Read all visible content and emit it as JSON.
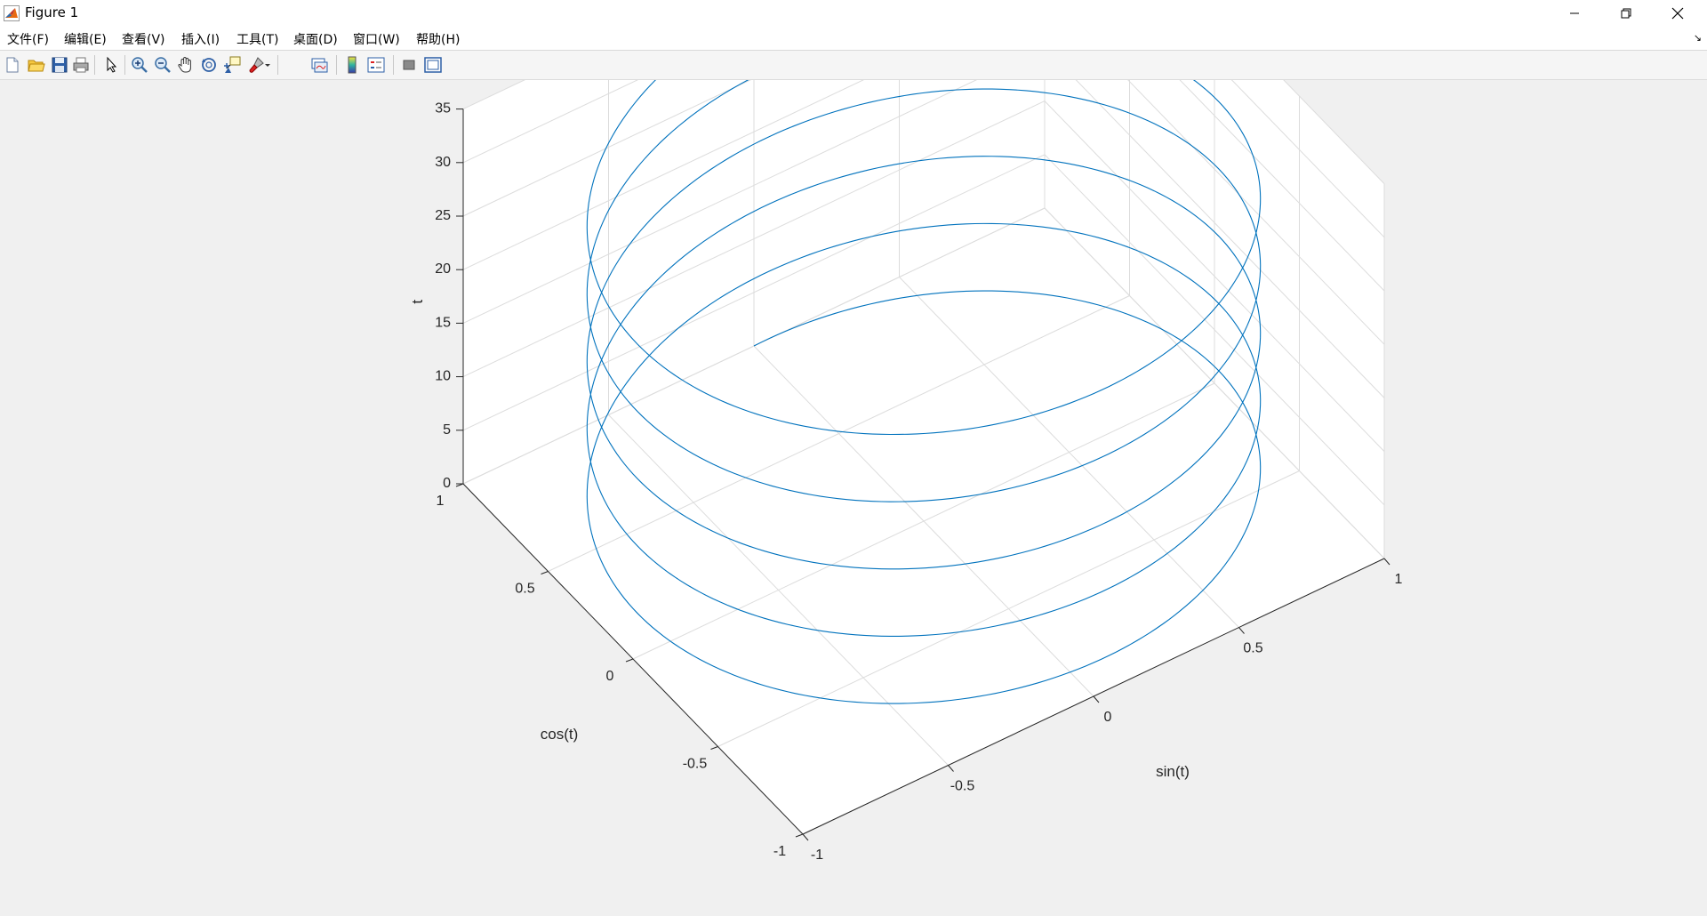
{
  "window": {
    "title": "Figure 1"
  },
  "menubar": {
    "items": [
      "文件(F)",
      "编辑(E)",
      "查看(V)",
      "插入(I)",
      "工具(T)",
      "桌面(D)",
      "窗口(W)",
      "帮助(H)"
    ]
  },
  "toolbar": {
    "buttons": [
      "new-figure",
      "open-file",
      "save",
      "print",
      "edit-plot",
      "zoom-in",
      "zoom-out",
      "pan",
      "rotate-3d",
      "data-cursor",
      "brush",
      "link-plot",
      "insert-colorbar",
      "insert-legend",
      "hide-plot-tools",
      "show-plot-tools"
    ]
  },
  "chart_data": {
    "type": "line3d",
    "title": "",
    "xlabel": "sin(t)",
    "ylabel": "cos(t)",
    "zlabel": "t",
    "xlim": [
      -1,
      1
    ],
    "ylim": [
      -1,
      1
    ],
    "zlim": [
      0,
      35
    ],
    "x_ticks": [
      "-1",
      "-0.5",
      "0",
      "0.5",
      "1"
    ],
    "y_ticks": [
      "-1",
      "-0.5",
      "0",
      "0.5",
      "1"
    ],
    "z_ticks": [
      "0",
      "5",
      "10",
      "15",
      "20",
      "25",
      "30",
      "35"
    ],
    "grid": true,
    "series": [
      {
        "x_expression": "sin(t)",
        "y_expression": "cos(t)",
        "z_expression": "t",
        "t_range": [
          0,
          31.4159
        ],
        "color": "#0072bd"
      }
    ]
  }
}
